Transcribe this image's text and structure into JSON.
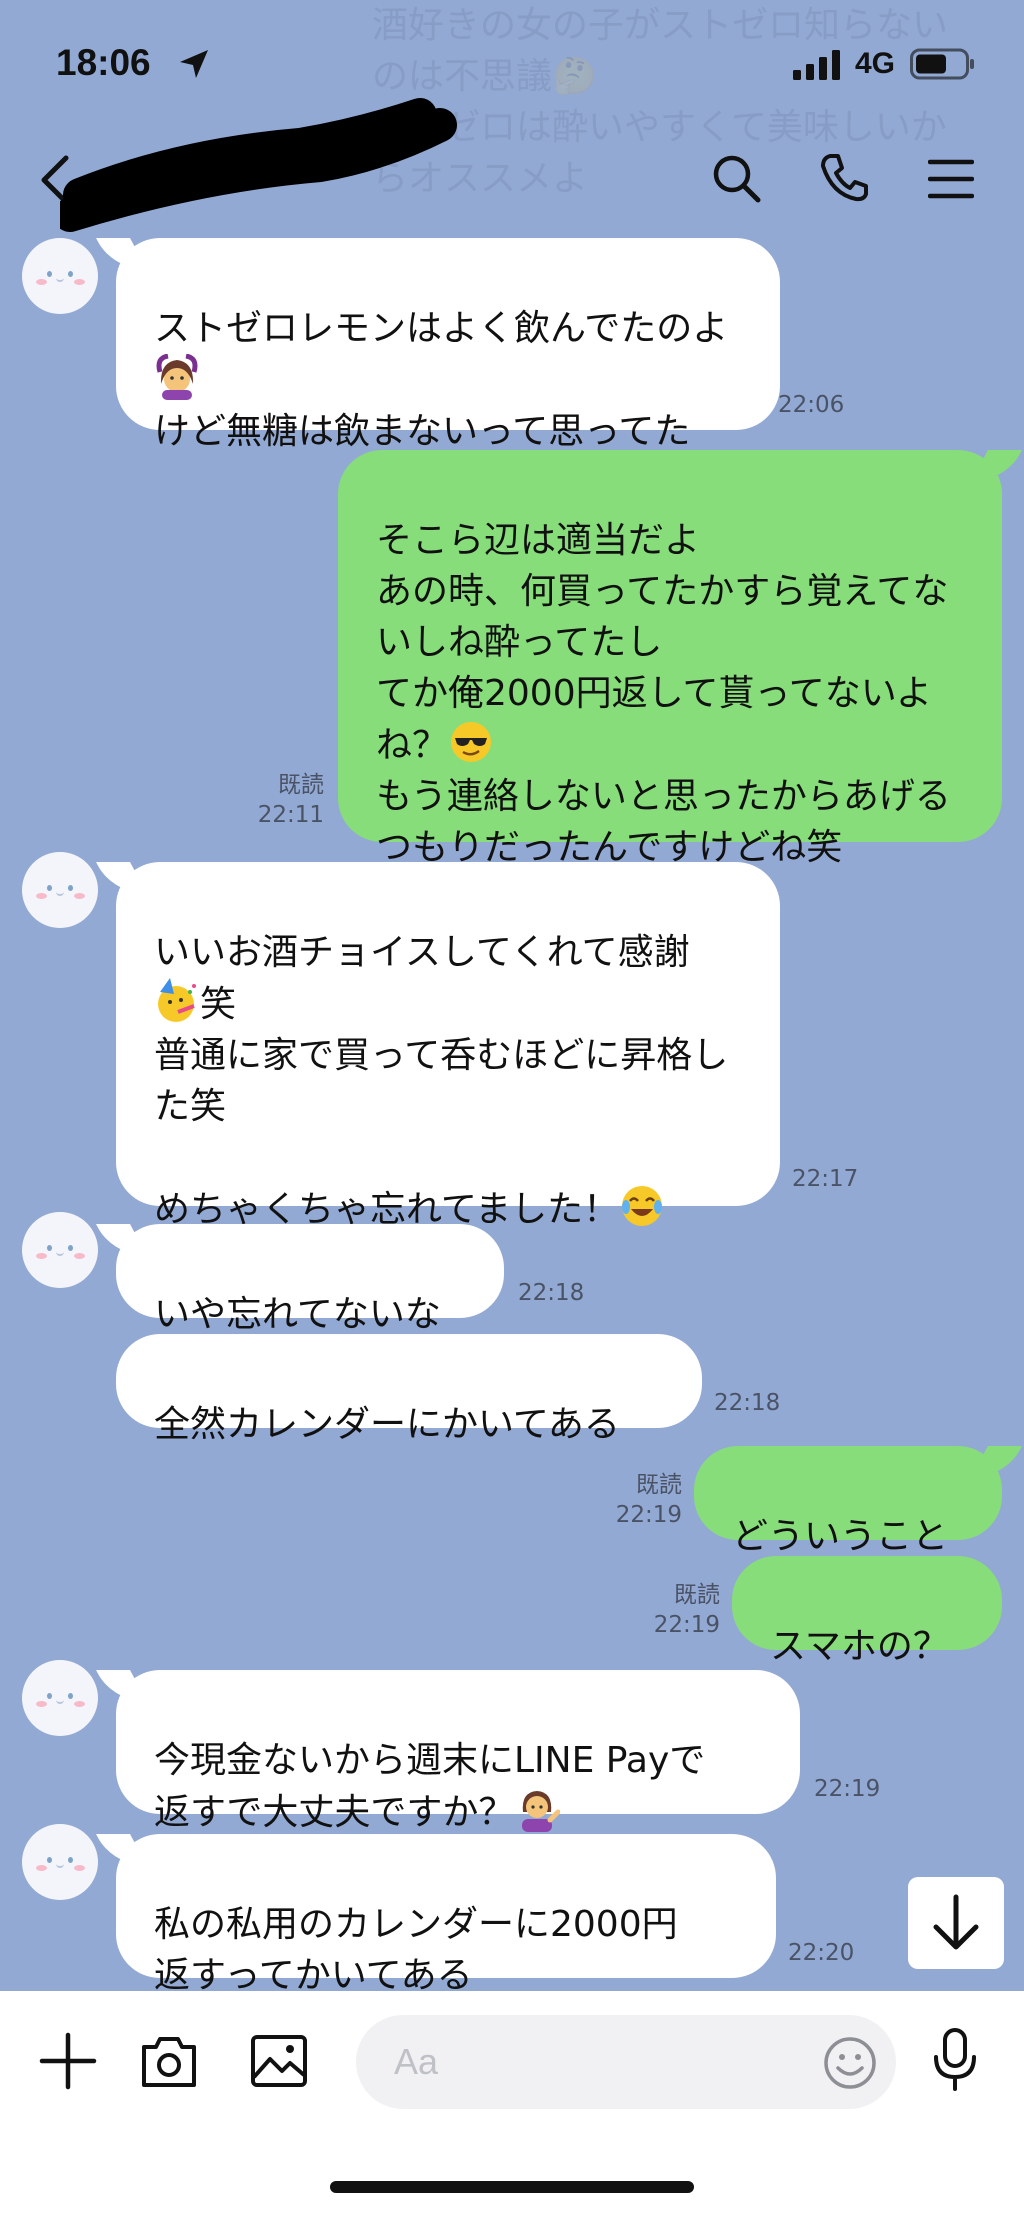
{
  "status_bar": {
    "time": "18:06",
    "network": "4G"
  },
  "notification_ghost": "酒好きの女の子がストゼロ知らないのは不思議🤔\nストゼロは酔いやすくて美味しいからオススメよ",
  "header": {
    "contact_name": "",
    "icons": [
      "back-icon",
      "search-icon",
      "call-icon",
      "menu-icon"
    ]
  },
  "messages": [
    {
      "side": "in",
      "text": "ストゼロレモンはよく飲んでたのよ",
      "emoji": "🙆‍♀️",
      "text2": "けど無糖は飲まないって思ってた",
      "time": "22:06"
    },
    {
      "side": "out",
      "read": "既読",
      "time": "22:11",
      "lines": [
        "そこら辺は適当だよ",
        "あの時、何買ってたかすら覚えてないしね酔ってたし",
        "てか俺2000円返して貰ってないよね？",
        "もう連絡しないと思ったからあげるつもりだったんですけどね笑"
      ],
      "emoji": "😎"
    },
    {
      "side": "in",
      "time": "22:17",
      "lines": [
        "いいお酒チョイスしてくれて感謝",
        "笑",
        "普通に家で買って呑むほどに昇格した笑",
        "めちゃくちゃ忘れてました！"
      ],
      "emoji1": "🥳",
      "emoji2": "😂"
    },
    {
      "side": "in",
      "text": "いや忘れてないな",
      "time": "22:18"
    },
    {
      "side": "in",
      "text": "全然カレンダーにかいてある",
      "time": "22:18"
    },
    {
      "side": "out",
      "text": "どういうこと",
      "read": "既読",
      "time": "22:19"
    },
    {
      "side": "out",
      "text": "スマホの？",
      "read": "既読",
      "time": "22:19"
    },
    {
      "side": "in",
      "lines": [
        "今現金ないから週末にLINE Payで",
        "返すで大丈夫ですか？"
      ],
      "emoji": "💁‍♀️",
      "time": "22:19"
    },
    {
      "side": "in",
      "lines": [
        "私の私用のカレンダーに2000円",
        "返すってかいてある"
      ],
      "time": "22:20"
    }
  ],
  "input": {
    "placeholder": "Aa"
  },
  "colors": {
    "background": "#92a9d3",
    "incoming": "#ffffff",
    "outgoing": "#88dd7b"
  }
}
